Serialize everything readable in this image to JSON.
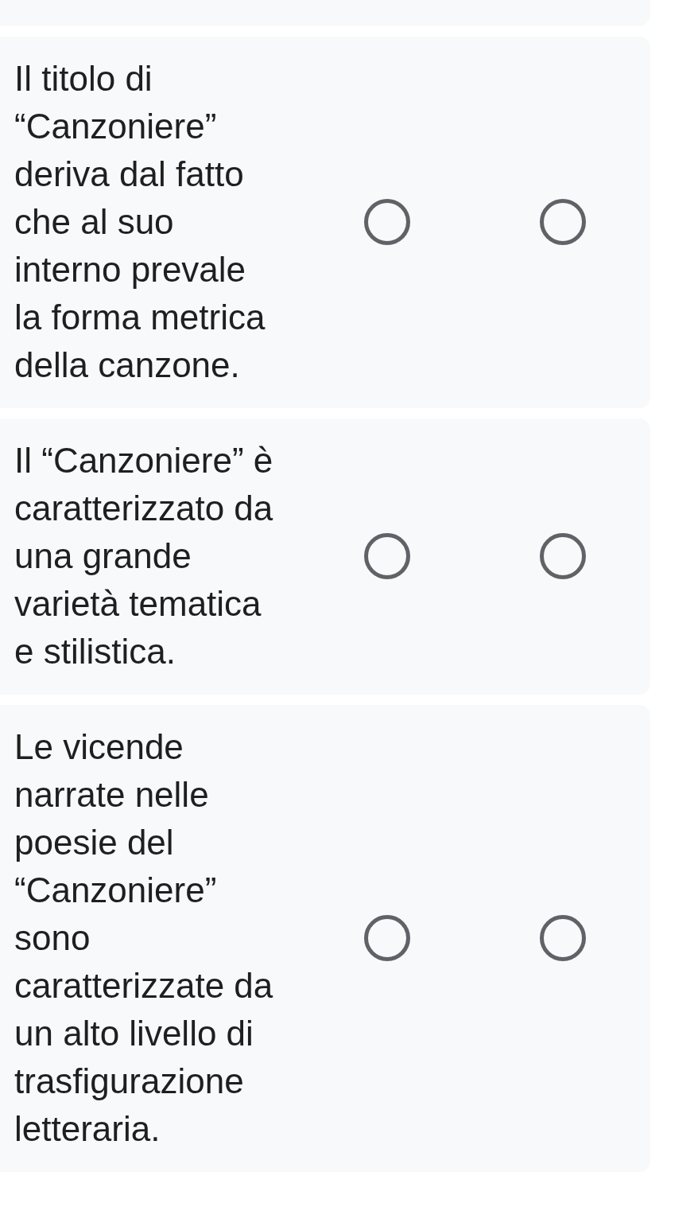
{
  "rows": [
    {
      "statement": "Il titolo di “Canzoniere” deriva dal fatto che al suo interno prevale la forma metrica della canzone.",
      "options": [
        {
          "selected": false
        },
        {
          "selected": false
        }
      ]
    },
    {
      "statement": "Il “Canzoniere” è caratterizzato da una grande varietà tematica e stilistica.",
      "options": [
        {
          "selected": false
        },
        {
          "selected": false
        }
      ]
    },
    {
      "statement": "Le vicende narrate nelle poesie del “Canzoniere” sono caratterizzate da un alto livello di trasfigurazione letteraria.",
      "options": [
        {
          "selected": false
        },
        {
          "selected": false
        }
      ]
    }
  ]
}
